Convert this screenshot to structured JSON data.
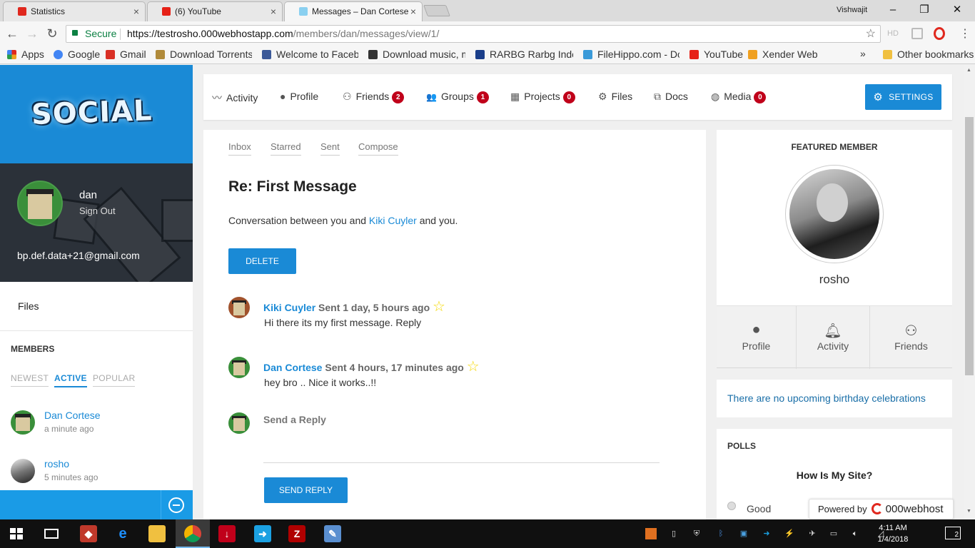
{
  "browser": {
    "tabs": [
      {
        "title": "Statistics",
        "color": "#e0281e"
      },
      {
        "title": "(6) YouTube",
        "color": "#e62117"
      },
      {
        "title": "Messages – Dan Cortese",
        "color": "#8ad0f0"
      }
    ],
    "window_user": "Vishwajit",
    "secure_label": "Secure",
    "url_main": "https://testrosho.000webhostapp.com",
    "url_path": "/members/dan/messages/view/1/",
    "hd_label": "HD",
    "bookmarks": [
      {
        "label": "Apps",
        "color": "#e0281e"
      },
      {
        "label": "Google",
        "color": "#4285f4"
      },
      {
        "label": "Gmail",
        "color": "#d93025"
      },
      {
        "label": "Download Torrents. F",
        "color": "#b08a3a"
      },
      {
        "label": "Welcome to Faceboo",
        "color": "#3b5998"
      },
      {
        "label": "Download music, mo",
        "color": "#333333"
      },
      {
        "label": "RARBG Rarbg Index p",
        "color": "#1a3e8a"
      },
      {
        "label": "FileHippo.com - Dow",
        "color": "#3a9ad9"
      },
      {
        "label": "YouTube",
        "color": "#e62117"
      },
      {
        "label": "Xender Web",
        "color": "#f0a020"
      }
    ],
    "bookmarks_more": "»",
    "other_bookmarks": "Other bookmarks"
  },
  "sidebar": {
    "logo_text": "SOCIAL",
    "user": {
      "name": "dan",
      "sign_out": "Sign Out",
      "email": "bp.def.data+21@gmail.com"
    },
    "files_link": "Files",
    "members_title": "MEMBERS",
    "member_tabs": [
      "NEWEST",
      "ACTIVE",
      "POPULAR"
    ],
    "active_member_tab": "ACTIVE",
    "members": [
      {
        "name": "Dan Cortese",
        "time": "a minute ago"
      },
      {
        "name": "rosho",
        "time": "5 minutes ago"
      }
    ]
  },
  "topnav": {
    "items": [
      {
        "label": "Activity",
        "icon": "activity-icon",
        "glyph": "〰",
        "badge": ""
      },
      {
        "label": "Profile",
        "icon": "profile-icon",
        "glyph": "●",
        "badge": ""
      },
      {
        "label": "Friends",
        "icon": "friends-icon",
        "glyph": "⚇",
        "badge": "2"
      },
      {
        "label": "Groups",
        "icon": "groups-icon",
        "glyph": "👥",
        "badge": "1"
      },
      {
        "label": "Projects",
        "icon": "projects-icon",
        "glyph": "▦",
        "badge": "0"
      },
      {
        "label": "Files",
        "icon": "gear-icon",
        "glyph": "⚙",
        "badge": ""
      },
      {
        "label": "Docs",
        "icon": "docs-icon",
        "glyph": "⧉",
        "badge": ""
      },
      {
        "label": "Media",
        "icon": "media-icon",
        "glyph": "◍",
        "badge": "0"
      }
    ],
    "settings_label": "SETTINGS"
  },
  "messages": {
    "tabs": [
      "Inbox",
      "Starred",
      "Sent",
      "Compose"
    ],
    "subject": "Re: First Message",
    "conversation_prefix": "Conversation between you and ",
    "conversation_user": "Kiki Cuyler",
    "conversation_suffix": " and you.",
    "delete_label": "DELETE",
    "thread": [
      {
        "sender": "Kiki Cuyler",
        "sent": "Sent 1 day, 5 hours ago",
        "body": "Hi there its my first message. Reply",
        "avatar_color": "#a0522d"
      },
      {
        "sender": "Dan Cortese",
        "sent": "Sent 4 hours, 17 minutes ago",
        "body": "hey bro .. Nice it works..!!",
        "avatar_color": "#3a8f3a"
      }
    ],
    "reply_label": "Send a Reply",
    "send_label": "SEND REPLY"
  },
  "featured": {
    "title": "FEATURED MEMBER",
    "name": "rosho",
    "buttons": [
      "Profile",
      "Activity",
      "Friends"
    ]
  },
  "birthday_text": "There are no upcoming birthday celebrations",
  "polls": {
    "title": "POLLS",
    "question": "How Is My Site?",
    "option": "Good"
  },
  "powered": {
    "prefix": "Powered by",
    "brand": "000webhost"
  },
  "taskbar": {
    "time": "4:11 AM",
    "date": "1/4/2018",
    "notification_count": "2"
  }
}
